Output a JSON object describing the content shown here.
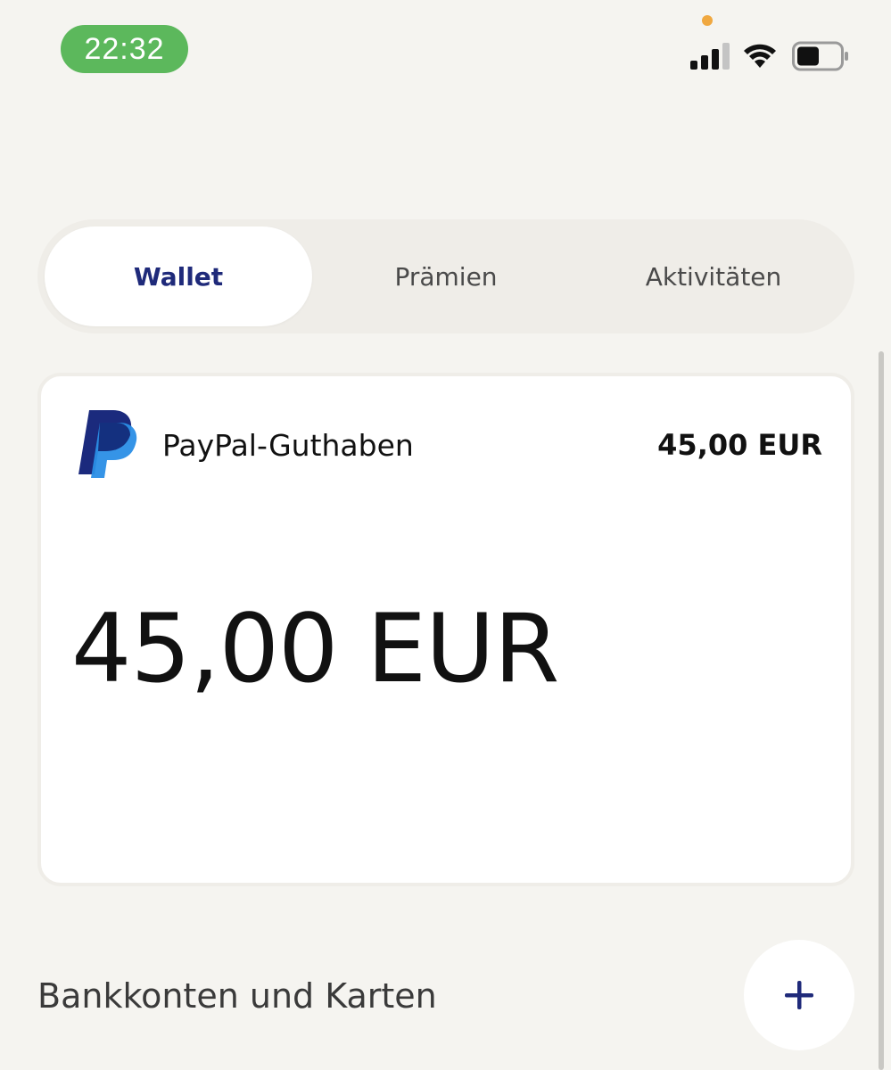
{
  "status_bar": {
    "time": "22:32",
    "time_pill_color": "#5cb85c",
    "privacy_dot_color": "#f0a840",
    "icons": [
      "signal-icon",
      "wifi-icon",
      "battery-icon"
    ]
  },
  "tabs": [
    {
      "label": "Wallet",
      "active": true
    },
    {
      "label": "Prämien",
      "active": false
    },
    {
      "label": "Aktivitäten",
      "active": false
    }
  ],
  "balance_card": {
    "logo": "paypal-logo",
    "title": "PayPal-Guthaben",
    "amount_small": "45,00 EUR",
    "amount_large": "45,00 EUR"
  },
  "bank_section": {
    "heading": "Bankkonten und Karten",
    "add_icon": "plus-icon"
  },
  "colors": {
    "background": "#f5f4f0",
    "active_tab_text": "#1f2a7a",
    "plus_icon": "#1f2a7a"
  }
}
